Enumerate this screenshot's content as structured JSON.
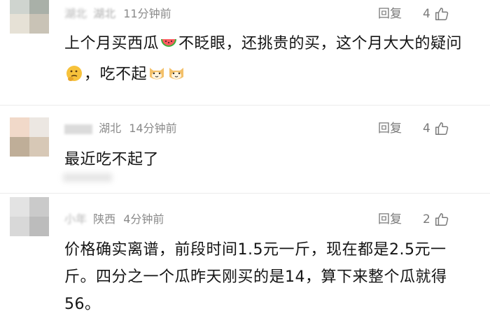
{
  "comments": [
    {
      "author": "湖北",
      "location": "湖北",
      "time": "11分钟前",
      "reply": "回复",
      "likes": "4",
      "text_parts": [
        "上个月买西瓜",
        "不眨眼，还挑贵的买，这个月大大的疑问",
        "，吃不起"
      ],
      "emojis": [
        "watermelon-emoji",
        "thinking-emoji",
        "cat-emoji",
        "cat-emoji"
      ]
    },
    {
      "author": "湖北",
      "location": "湖北",
      "time": "14分钟前",
      "reply": "回复",
      "likes": "4",
      "text": "最近吃不起了"
    },
    {
      "author": "小年",
      "location": "陕西",
      "time": "4分钟前",
      "reply": "回复",
      "likes": "2",
      "text": "价格确实离谱，前段时间1.5元一斤，现在都是2.5元一斤。四分之一个瓜昨天刚买的是14，算下来整个瓜就得56。"
    }
  ],
  "colors": {
    "meta": "#8a8a8a",
    "text": "#141414",
    "divider": "#ebebeb"
  }
}
